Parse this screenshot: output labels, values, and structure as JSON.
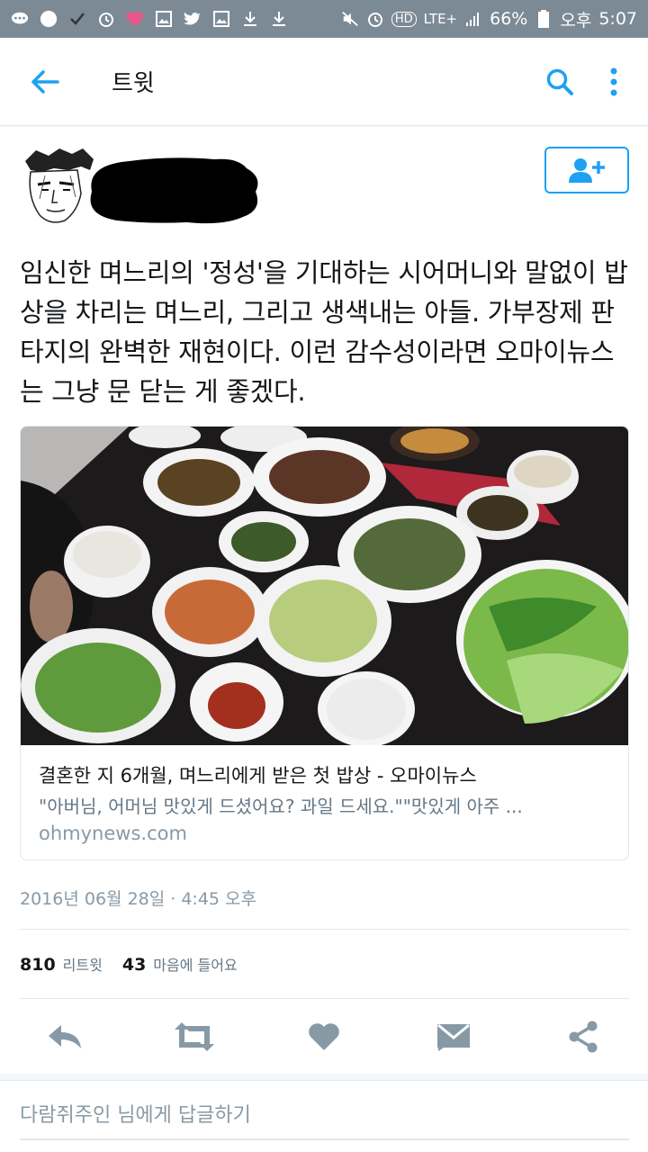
{
  "status_bar": {
    "battery": "66%",
    "ampm": "오후",
    "time": "5:07",
    "network": "LTE+",
    "hd": "HD"
  },
  "appbar": {
    "title": "트윗",
    "back_icon": "arrow-left-icon",
    "search_icon": "search-icon",
    "more_icon": "more-vertical-icon"
  },
  "tweet": {
    "text": "임신한 며느리의 '정성'을 기대하는 시어머니와 말없이 밥상을 차리는 며느리, 그리고 생색내는 아들. 가부장제 판타지의 완벽한 재현이다. 이런 감수성이라면 오마이뉴스는 그냥 문 닫는 게 좋겠다.",
    "card": {
      "title": "결혼한 지 6개월, 며느리에게 받은 첫 밥상 - 오마이뉴스",
      "description": "\"아버님, 어머님 맛있게 드셨어요? 과일 드세요.\"\"맛있게 아주 ...",
      "domain": "ohmynews.com"
    },
    "timestamp": "2016년 06월 28일 · 4:45 오후",
    "retweet_count": "810",
    "retweet_label": "리트윗",
    "like_count": "43",
    "like_label": "마음에 들어요"
  },
  "reply": {
    "placeholder": "다람쥐주인 님에게 답글하기"
  },
  "colors": {
    "accent": "#1da1f2",
    "icon_gray": "#8899a6",
    "status_bar": "#7c8a96"
  }
}
